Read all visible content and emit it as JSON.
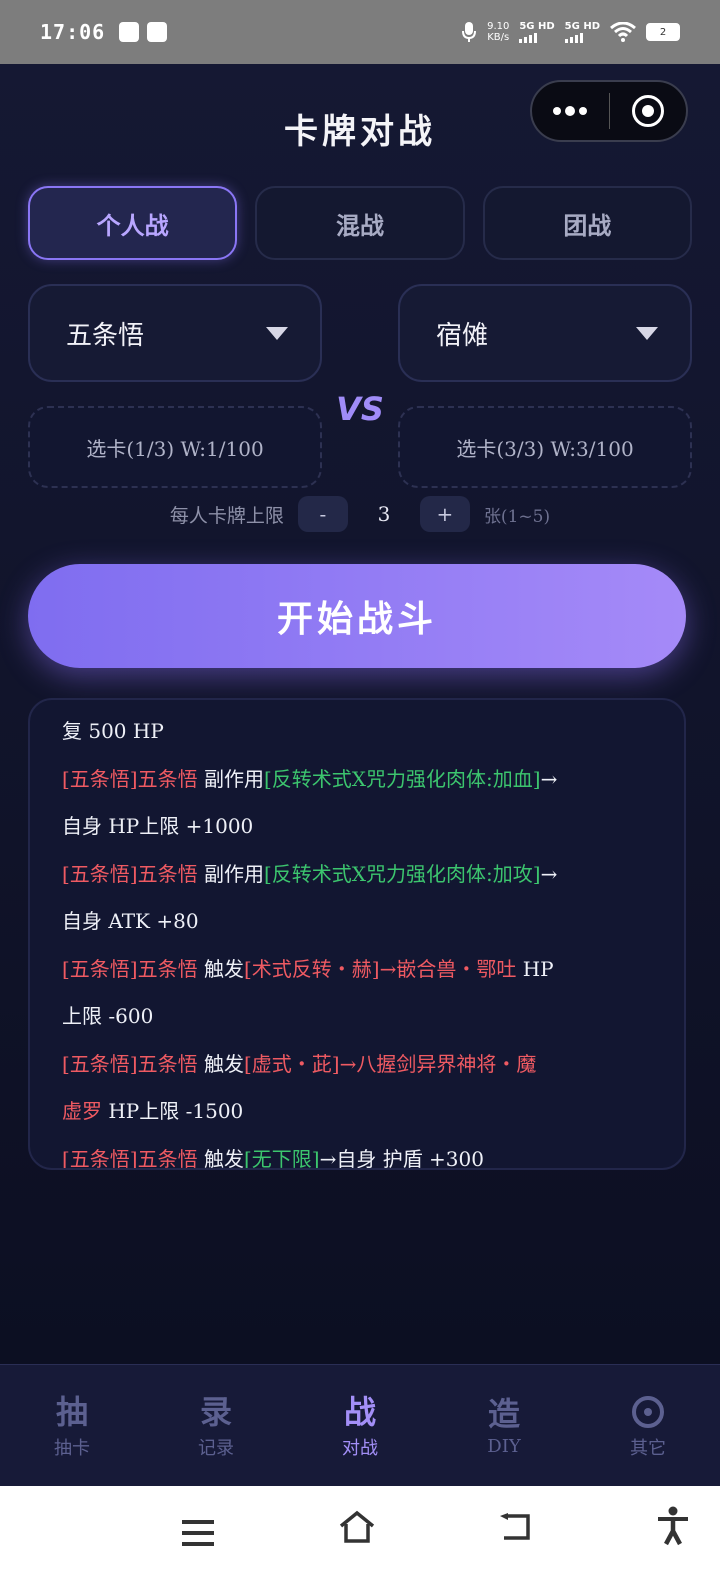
{
  "status_bar": {
    "time": "17:06",
    "net_speed_value": "9.10",
    "net_speed_unit": "KB/s",
    "signal1": "5G HD",
    "signal2": "5G HD",
    "battery": "2"
  },
  "header": {
    "title": "卡牌对战"
  },
  "tabs": [
    {
      "label": "个人战",
      "active": true
    },
    {
      "label": "混战",
      "active": false
    },
    {
      "label": "团战",
      "active": false
    }
  ],
  "battle": {
    "left_character": "五条悟",
    "right_character": "宿傩",
    "vs_label": "VS",
    "left_card_picker": "选卡(1/3) W:1/100",
    "right_card_picker": "选卡(3/3) W:3/100",
    "limit_label": "每人卡牌上限",
    "limit_minus": "-",
    "limit_value": "3",
    "limit_plus": "+",
    "limit_unit": "张(1~5)",
    "start_button": "开始战斗"
  },
  "log": {
    "l0": "复 500 HP",
    "l1a": "[五条悟]五条悟",
    "l1b": " 副作用",
    "l1c": "[反转术式X咒力强化肉体:加血]",
    "l1d": "→",
    "l2": "自身 HP上限 +1000",
    "l3a": "[五条悟]五条悟",
    "l3b": " 副作用",
    "l3c": "[反转术式X咒力强化肉体:加攻]",
    "l3d": "→",
    "l4": "自身 ATK +80",
    "l5a": "[五条悟]五条悟",
    "l5b": " 触发",
    "l5c": "[术式反转・赫]",
    "l5d": "→嵌合兽・鄂吐",
    "l5e": " HP",
    "l6": "上限 -600",
    "l7a": "[五条悟]五条悟",
    "l7b": " 触发",
    "l7c": "[虚式・茈]",
    "l7d": "→八握剑异界神将・魔",
    "l8a": "虚罗",
    "l8b": " HP上限 -1500",
    "l9a": "[五条悟]五条悟",
    "l9b": " 触发",
    "l9c": "[无下限]",
    "l9d": "→自身 护盾 +300"
  },
  "bottom_nav": [
    {
      "glyph": "抽",
      "label": "抽卡",
      "active": false
    },
    {
      "glyph": "录",
      "label": "记录",
      "active": false
    },
    {
      "glyph": "战",
      "label": "对战",
      "active": true
    },
    {
      "glyph": "造",
      "label": "DIY",
      "active": false
    },
    {
      "icon": "gear-icon",
      "label": "其它",
      "active": false
    }
  ],
  "colors": {
    "accent": "#a38ff7",
    "log_red": "#ef5a62",
    "log_green": "#3cc56e",
    "background": "#0f1226"
  }
}
